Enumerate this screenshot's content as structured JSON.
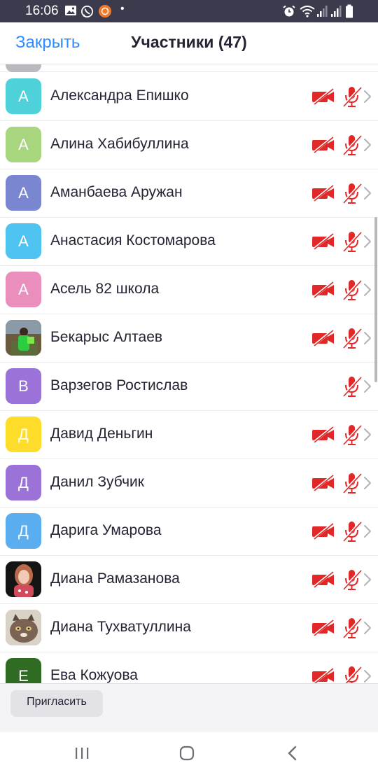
{
  "status_bar": {
    "time": "16:06",
    "left_icons": [
      "gallery-icon",
      "whatsapp-icon",
      "app-notification-icon"
    ],
    "dot": "•",
    "right_icons": [
      "alarm-icon",
      "wifi-icon",
      "signal-icon",
      "signal-icon",
      "battery-icon"
    ]
  },
  "header": {
    "close_label": "Закрыть",
    "title": "Участники (47)"
  },
  "participants": [
    {
      "initial": "А",
      "name": "Александра Епишко",
      "avatar_color": "#4fd1d9",
      "video_off": true,
      "audio_muted": true
    },
    {
      "initial": "А",
      "name": "Алина Хабибуллина",
      "avatar_color": "#a8d67f",
      "video_off": true,
      "audio_muted": true
    },
    {
      "initial": "А",
      "name": "Аманбаева Аружан",
      "avatar_color": "#7b86d1",
      "video_off": true,
      "audio_muted": true
    },
    {
      "initial": "А",
      "name": "Анастасия Костомарова",
      "avatar_color": "#4ec3f0",
      "video_off": true,
      "audio_muted": true
    },
    {
      "initial": "А",
      "name": "Асель 82 школа",
      "avatar_color": "#ea8fbd",
      "video_off": true,
      "audio_muted": true
    },
    {
      "initial": "",
      "name": "Бекарыс Алтаев",
      "avatar_color": "#4b8a3a",
      "photo": true,
      "video_off": true,
      "audio_muted": true
    },
    {
      "initial": "В",
      "name": "Варзегов Ростислав",
      "avatar_color": "#9a72d8",
      "video_off": false,
      "audio_muted": true
    },
    {
      "initial": "Д",
      "name": "Давид Деньгин",
      "avatar_color": "#fedd2a",
      "video_off": true,
      "audio_muted": true
    },
    {
      "initial": "Д",
      "name": "Данил Зубчик",
      "avatar_color": "#9a72d8",
      "video_off": true,
      "audio_muted": true
    },
    {
      "initial": "Д",
      "name": "Дарига Умарова",
      "avatar_color": "#5aaef0",
      "video_off": true,
      "audio_muted": true
    },
    {
      "initial": "",
      "name": "Диана Рамазанова",
      "avatar_color": "#c98f7c",
      "photo": true,
      "video_off": true,
      "audio_muted": true
    },
    {
      "initial": "",
      "name": "Диана Тухватуллина",
      "avatar_color": "#8b7a6d",
      "photo": true,
      "video_off": true,
      "audio_muted": true
    },
    {
      "initial": "Е",
      "name": "Ева Кожуова",
      "avatar_color": "#2f6b22",
      "video_off": true,
      "audio_muted": true
    }
  ],
  "footer": {
    "invite_label": "Пригласить"
  },
  "navigation": {
    "buttons": [
      "recent-apps-icon",
      "home-icon",
      "back-icon"
    ]
  },
  "colors": {
    "accent": "#2d8cff",
    "muted_red": "#e02828",
    "status_bar": "#3b3b4d"
  }
}
